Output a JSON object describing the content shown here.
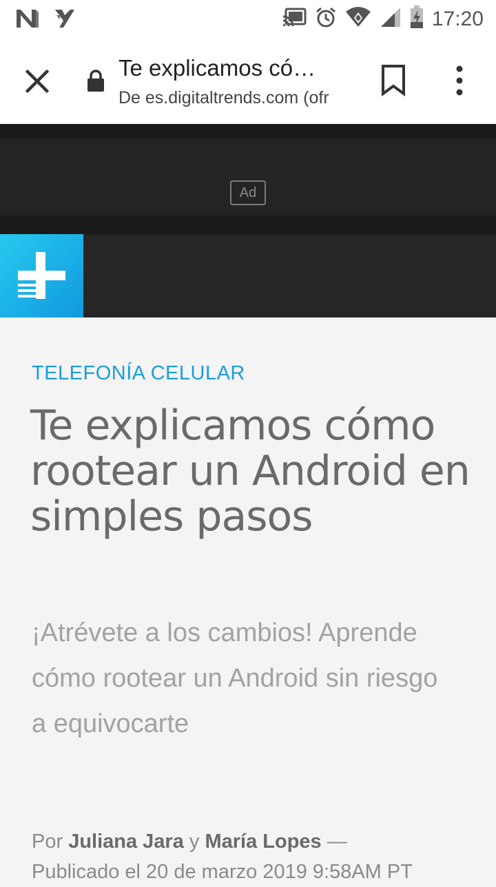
{
  "status_bar": {
    "time": "17:20",
    "icons": [
      "n-logo-icon",
      "check-logo-icon",
      "cast-icon",
      "alarm-icon",
      "wifi-icon",
      "signal-icon",
      "battery-icon"
    ]
  },
  "toolbar": {
    "title": "Te explicamos có…",
    "url": "De es.digitaltrends.com (ofr",
    "icons": [
      "close-icon",
      "lock-icon",
      "bookmark-icon",
      "more-vert-icon"
    ]
  },
  "ad": {
    "badge": "Ad"
  },
  "article": {
    "category": "TELEFONÍA CELULAR",
    "headline": "Te explicamos cómo rootear un Android en simples pasos",
    "subtitle": "¡Atrévete a los cambios! Aprende cómo rootear un Android sin riesgo a equivocarte",
    "byline": {
      "prefix": "Por ",
      "author1": "Juliana Jara",
      "conjunction": " y ",
      "author2": "María Lopes",
      "dash": " —",
      "published": "Publicado el 20 de marzo 2019 9:58AM PT"
    }
  },
  "colors": {
    "accent": "#1a9ed9",
    "logo_gradient_start": "#27c9ef",
    "logo_gradient_end": "#1199df"
  }
}
